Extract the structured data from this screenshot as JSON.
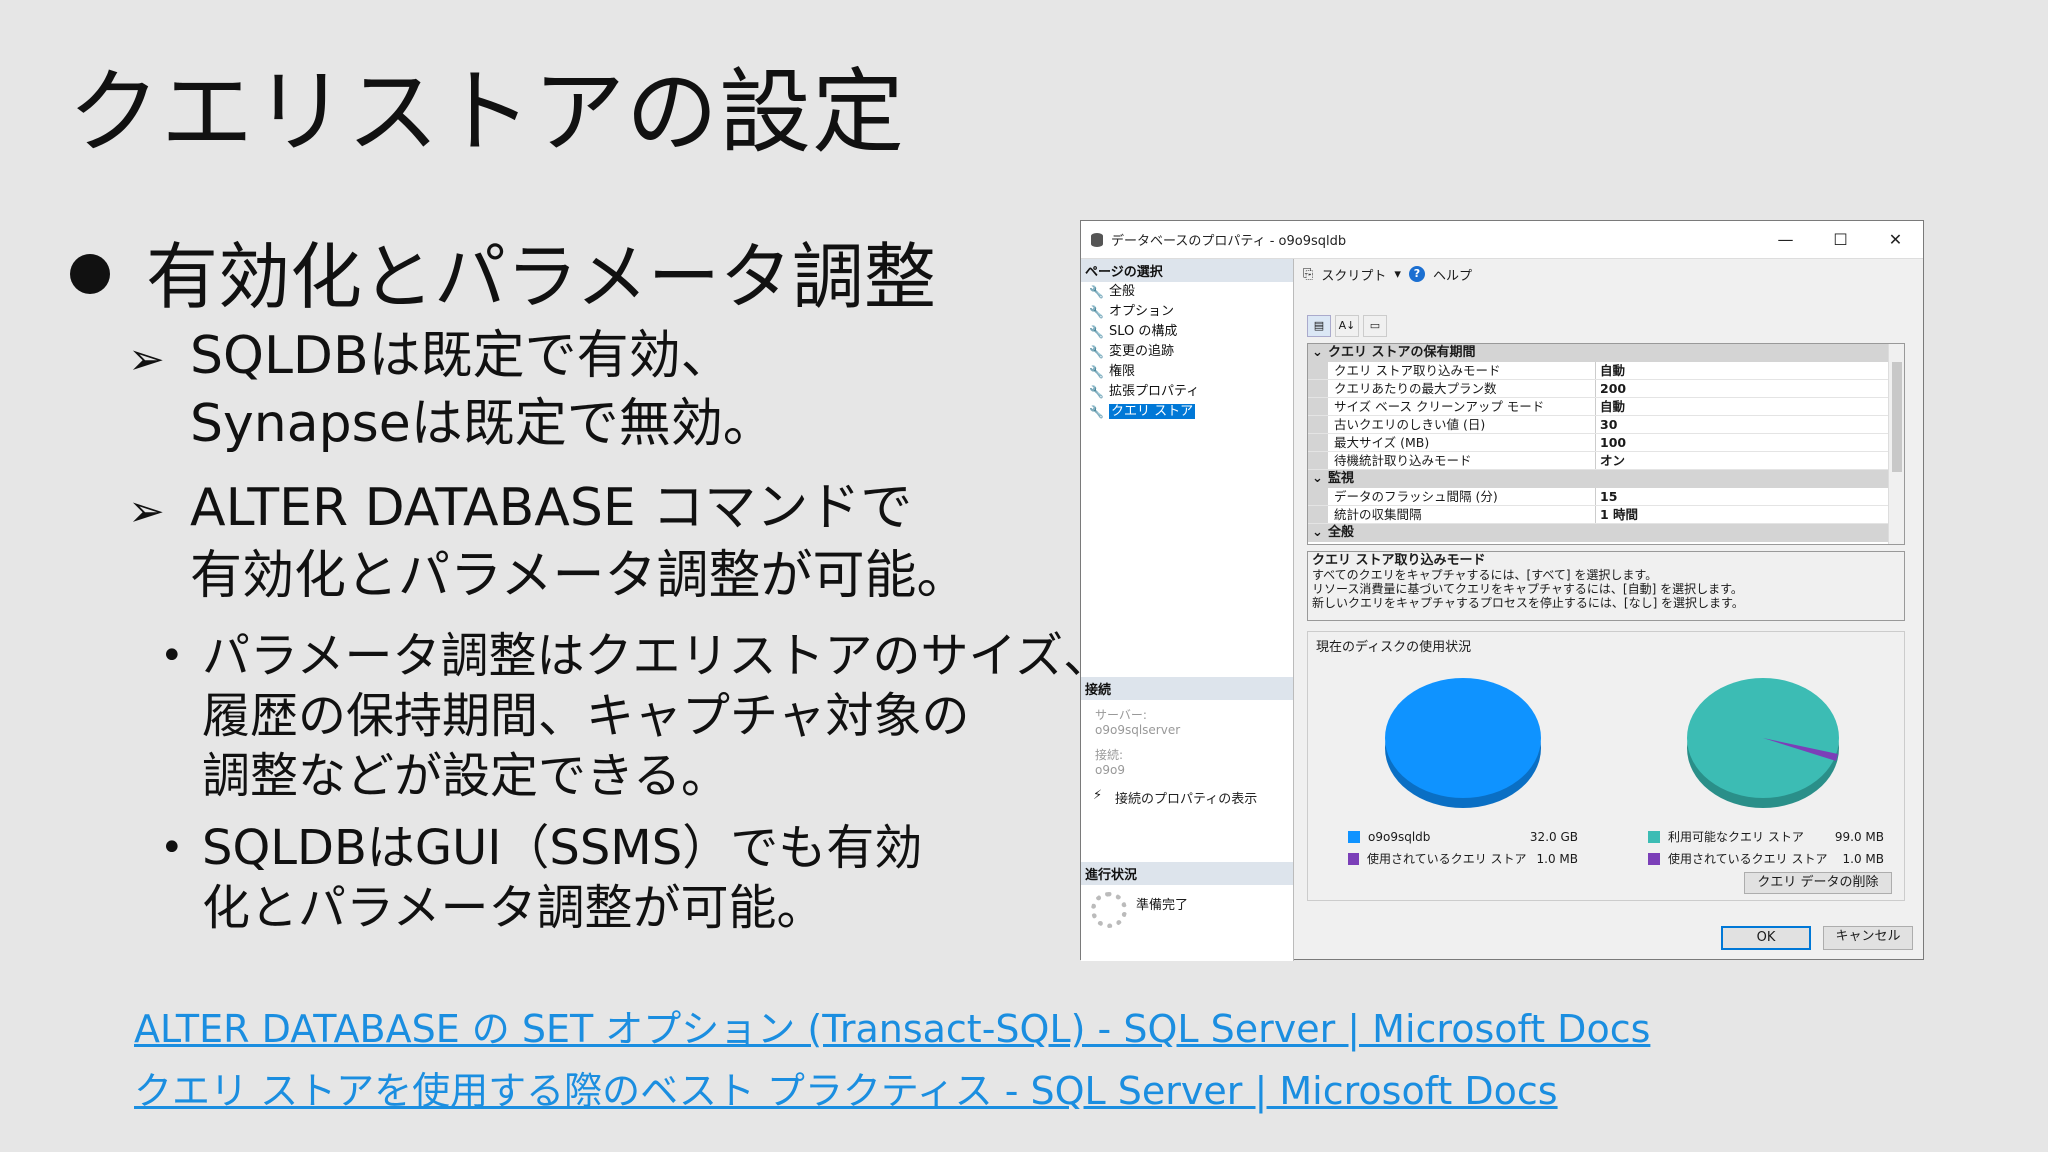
{
  "slide": {
    "title": "クエリストアの設定",
    "bullet": "有効化とパラメータ調整",
    "arrow_items": [
      [
        "SQLDBは既定で有効、",
        "Synapseは既定で無効。"
      ],
      [
        "ALTER DATABASE コマンドで",
        "有効化とパラメータ調整が可能。"
      ]
    ],
    "sub_items": [
      [
        "パラメータ調整はクエリストアのサイズ、",
        "履歴の保持期間、キャプチャ対象の",
        "調整などが設定できる。"
      ],
      [
        "SQLDBはGUI（SSMS）でも有効",
        "化とパラメータ調整が可能。"
      ]
    ],
    "links": [
      "ALTER DATABASE の SET オプション (Transact-SQL) - SQL Server | Microsoft Docs",
      "クエリ ストアを使用する際のベスト プラクティス - SQL Server | Microsoft Docs"
    ]
  },
  "dialog": {
    "title": "データベースのプロパティ - o9o9sqldb",
    "window_buttons": [
      "—",
      "☐",
      "✕"
    ],
    "left": {
      "pages_header": "ページの選択",
      "pages": [
        "全般",
        "オプション",
        "SLO の構成",
        "変更の追跡",
        "権限",
        "拡張プロパティ",
        "クエリ ストア"
      ],
      "connection_header": "接続",
      "server_label": "サーバー:",
      "server_value": "o9o9sqlserver",
      "conn_label": "接続:",
      "conn_value": "o9o9",
      "conn_link": "接続のプロパティの表示",
      "progress_header": "進行状況",
      "progress_text": "準備完了"
    },
    "toolbar": {
      "script": "スクリプト",
      "help": "ヘルプ"
    },
    "grid": {
      "cat1": "クエリ ストアの保有期間",
      "rows1": [
        {
          "k": "クエリ ストア取り込みモード",
          "v": "自動"
        },
        {
          "k": "クエリあたりの最大プラン数",
          "v": "200"
        },
        {
          "k": "サイズ ベース クリーンアップ モード",
          "v": "自動"
        },
        {
          "k": "古いクエリのしきい値 (日)",
          "v": "30"
        },
        {
          "k": "最大サイズ (MB)",
          "v": "100"
        },
        {
          "k": "待機統計取り込みモード",
          "v": "オン"
        }
      ],
      "cat2": "監視",
      "rows2": [
        {
          "k": "データのフラッシュ間隔 (分)",
          "v": "15"
        },
        {
          "k": "統計の収集間隔",
          "v": "1 時間"
        }
      ],
      "cat3": "全般"
    },
    "description": {
      "title": "クエリ ストア取り込みモード",
      "lines": [
        "すべてのクエリをキャプチャするには、[すべて] を選択します。",
        "リソース消費量に基づいてクエリをキャプチャするには、[自動] を選択します。",
        "新しいクエリをキャプチャするプロセスを停止するには、[なし] を選択します。"
      ]
    },
    "disk": {
      "title": "現在のディスクの使用状況",
      "left_legend": [
        {
          "name": "o9o9sqldb",
          "value": "32.0 GB",
          "color": "#0f93ff"
        },
        {
          "name": "使用されているクエリ ストア",
          "value": "1.0 MB",
          "color": "#7b3fb8"
        }
      ],
      "right_legend": [
        {
          "name": "利用可能なクエリ ストア",
          "value": "99.0 MB",
          "color": "#3cbcb4"
        },
        {
          "name": "使用されているクエリ ストア",
          "value": "1.0 MB",
          "color": "#7b3fb8"
        }
      ],
      "clear_button": "クエリ データの削除"
    },
    "ok": "OK",
    "cancel": "キャンセル"
  }
}
